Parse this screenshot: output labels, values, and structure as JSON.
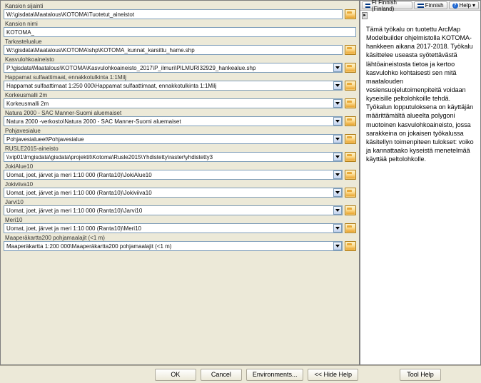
{
  "lang_btn": "FI Finnish (Finland)",
  "finnish_btn": "Finnish",
  "help_btn": "Help",
  "collapse": "▸",
  "help_text": "Tämä työkalu on tuotettu ArcMap Modelbuilder ohjelmistolla KOTOMA-hankkeen aikana 2017-2018. Työkalu käsittelee useasta syötettävästä lähtöaineistosta tietoa ja kertoo kasvulohko kohtaisesti sen mitä maatalouden vesiensuojelutoimenpiteitä voidaan kyseisille peltolohkoille tehdä. Työkalun lopputuloksena on käyttäjän määrittämältä alueelta polygoni muotoinen kasvulohkoaineisto, jossa sarakkeina on jokaisen työkalussa käsitellyn toimenpiteen tulokset: voiko ja kannattaako kyseistä menetelmää käyttää peltolohkolle.",
  "fields": {
    "f0": {
      "label": "Kansion sijainti",
      "value": "W:\\gisdata\\Maatalous\\KOTOMA\\Tuotetut_aineistot"
    },
    "f1": {
      "label": "Kansion nimi",
      "value": "KOTOMA_"
    },
    "f2": {
      "label": "Tarkastelualue",
      "value": "W:\\gisdata\\Maatalous\\KOTOMA\\shp\\KOTOMA_kunnat_karsittu_hame.shp"
    },
    "f3": {
      "label": "Kasvulohkoaineisto",
      "value": "P:\\gisdata\\Maatalous\\KOTOMA\\Kasvulohkoaineisto_2017\\P_ilmuri\\PILMURI32929_hankealue.shp"
    },
    "f4": {
      "label": "Happamat sulfaattimaat, ennakkotulkinta 1:1Milj",
      "value": "Happamat sulfaattimaat 1:250 000\\Happamat sulfaattimaat, ennakkotulkinta 1:1Milj"
    },
    "f5": {
      "label": "Korkeusmalli 2m",
      "value": "Korkeusmalli 2m"
    },
    "f6": {
      "label": "Natura 2000 - SAC Manner-Suomi aluemaiset",
      "value": "Natura 2000 -verkosto\\Natura 2000 - SAC Manner-Suomi aluemaiset"
    },
    "f7": {
      "label": "Pohjavesialue",
      "value": "Pohjavesialueet\\Pohjavesialue"
    },
    "f8": {
      "label": "RUSLE2015-aineisto",
      "value": "\\\\vip01\\lmgisdata\\gisdata\\projektit\\Kotoma\\Rusle2015\\Yhdistetty\\raster\\yhdistetty3"
    },
    "f9": {
      "label": "JokiAlue10",
      "value": "Uomat, joet, järvet ja meri 1:10 000 (Ranta10)\\JokiAlue10"
    },
    "f10": {
      "label": "Jokiviiva10",
      "value": "Uomat, joet, järvet ja meri 1:10 000 (Ranta10)\\Jokiviiva10"
    },
    "f11": {
      "label": "Jarvi10",
      "value": "Uomat, joet, järvet ja meri 1:10 000 (Ranta10)\\Jarvi10"
    },
    "f12": {
      "label": "Meri10",
      "value": "Uomat, joet, järvet ja meri 1:10 000 (Ranta10)\\Meri10"
    },
    "f13": {
      "label": "Maaperäkartta200 pohjamaalajit (<1 m)",
      "value": "Maaperäkartta 1:200 000\\Maaperäkartta200 pohjamaalajit (<1 m)"
    }
  },
  "buttons": {
    "ok": "OK",
    "cancel": "Cancel",
    "env": "Environments...",
    "hide": "<< Hide Help",
    "toolhelp": "Tool Help"
  }
}
